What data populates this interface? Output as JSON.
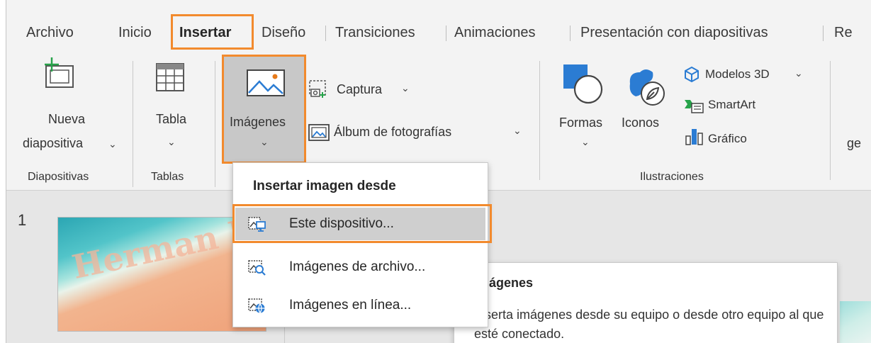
{
  "tabs": [
    {
      "label": "Archivo"
    },
    {
      "label": "Inicio"
    },
    {
      "label": "Insertar"
    },
    {
      "label": "Diseño"
    },
    {
      "label": "Transiciones"
    },
    {
      "label": "Animaciones"
    },
    {
      "label": "Presentación con diapositivas"
    },
    {
      "label": "Re"
    }
  ],
  "ribbon": {
    "nueva_line1": "Nueva",
    "nueva_line2": "diapositiva",
    "tabla": "Tabla",
    "imagenes": "Imágenes",
    "captura": "Captura",
    "album": "Álbum de fotografías",
    "formas": "Formas",
    "iconos": "Iconos",
    "modelos3d": "Modelos 3D",
    "smartart": "SmartArt",
    "grafico": "Gráfico",
    "cut_label": "ge"
  },
  "groups": {
    "diapositivas": "Diapositivas",
    "tablas": "Tablas",
    "ilustraciones": "Ilustraciones"
  },
  "dropdown": {
    "header": "Insertar imagen desde",
    "items": [
      {
        "label": "Este dispositivo..."
      },
      {
        "label": "Imágenes de archivo..."
      },
      {
        "label": "Imágenes en línea..."
      }
    ]
  },
  "tooltip": {
    "title": "Imágenes",
    "body": "Inserta imágenes desde su equipo o desde otro equipo al que esté conectado."
  },
  "slides": {
    "number": "1",
    "watermark": "Herman I"
  },
  "colors": {
    "highlight": "#f28a2d",
    "accent_blue": "#2b7cd3"
  }
}
